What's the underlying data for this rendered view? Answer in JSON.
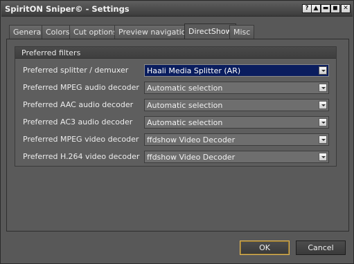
{
  "window": {
    "title": "SpiritON Sniper© - Settings",
    "title_buttons": [
      "?",
      "▲",
      "▬",
      "◼",
      "✕"
    ]
  },
  "tabs": [
    {
      "label": "General"
    },
    {
      "label": "Colors"
    },
    {
      "label": "Cut options"
    },
    {
      "label": "Preview navigation"
    },
    {
      "label": "DirectShow",
      "active": true
    },
    {
      "label": "Misc"
    }
  ],
  "group": {
    "title": "Preferred filters",
    "rows": [
      {
        "label": "Preferred splitter / demuxer",
        "value": "Haali Media Splitter (AR)",
        "focused": true
      },
      {
        "label": "Preferred MPEG audio decoder",
        "value": "Automatic selection"
      },
      {
        "label": "Preferred AAC audio decoder",
        "value": "Automatic selection"
      },
      {
        "label": "Preferred AC3 audio decoder",
        "value": "Automatic selection"
      },
      {
        "label": "Preferred MPEG video decoder",
        "value": "ffdshow Video Decoder"
      },
      {
        "label": "Preferred H.264 video decoder",
        "value": "ffdshow Video Decoder"
      }
    ]
  },
  "buttons": {
    "ok": "OK",
    "cancel": "Cancel"
  },
  "colors": {
    "focused_combo": "#0a1d5e",
    "default_button_border": "#e1b657"
  }
}
